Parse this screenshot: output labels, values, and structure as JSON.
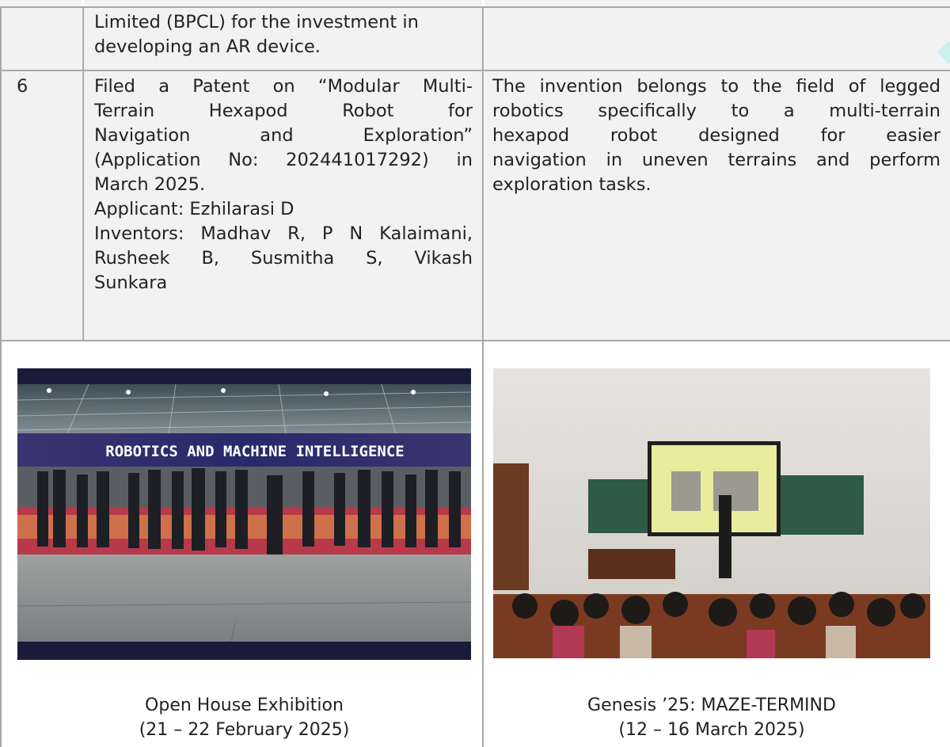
{
  "row_prev": {
    "description_lines": [
      "Limited (BPCL) for the investment in",
      "developing an AR device."
    ]
  },
  "row_6": {
    "number": "6",
    "description_lines": [
      "Filed a Patent on “Modular Multi-",
      "Terrain Hexapod Robot for",
      "Navigation and Exploration”",
      "(Application No: 202441017292) in",
      "March 2025.",
      "Applicant: Ezhilarasi D",
      "Inventors: Madhav R, P N Kalaimani,",
      "Rusheek B, Susmitha S, Vikash",
      "Sunkara"
    ],
    "remarks_lines": [
      "The invention belongs to the field of legged",
      "robotics specifically to a multi-terrain",
      "hexapod robot designed for easier",
      "navigation in uneven terrains and perform",
      "exploration tasks."
    ]
  },
  "gallery": {
    "left": {
      "banner_text": "ROBOTICS AND MACHINE INTELLIGENCE",
      "caption_line1": "Open House Exhibition",
      "caption_line2": "(21 – 22 February 2025)"
    },
    "right": {
      "caption_line1": "Genesis ’25: MAZE-TERMIND",
      "caption_line2": "(12 – 16 March 2025)"
    }
  },
  "colors": {
    "cell_shade": "#f2f2f2",
    "grid_line": "#a8a8a8",
    "banner_bg": "#2b2d6e",
    "hall_floor": "#8c8f8f",
    "carpet": "#b72a3c",
    "board_green": "#2f5a45",
    "wall": "#dcd9d2",
    "accent_teal": "#c9f0ee"
  }
}
